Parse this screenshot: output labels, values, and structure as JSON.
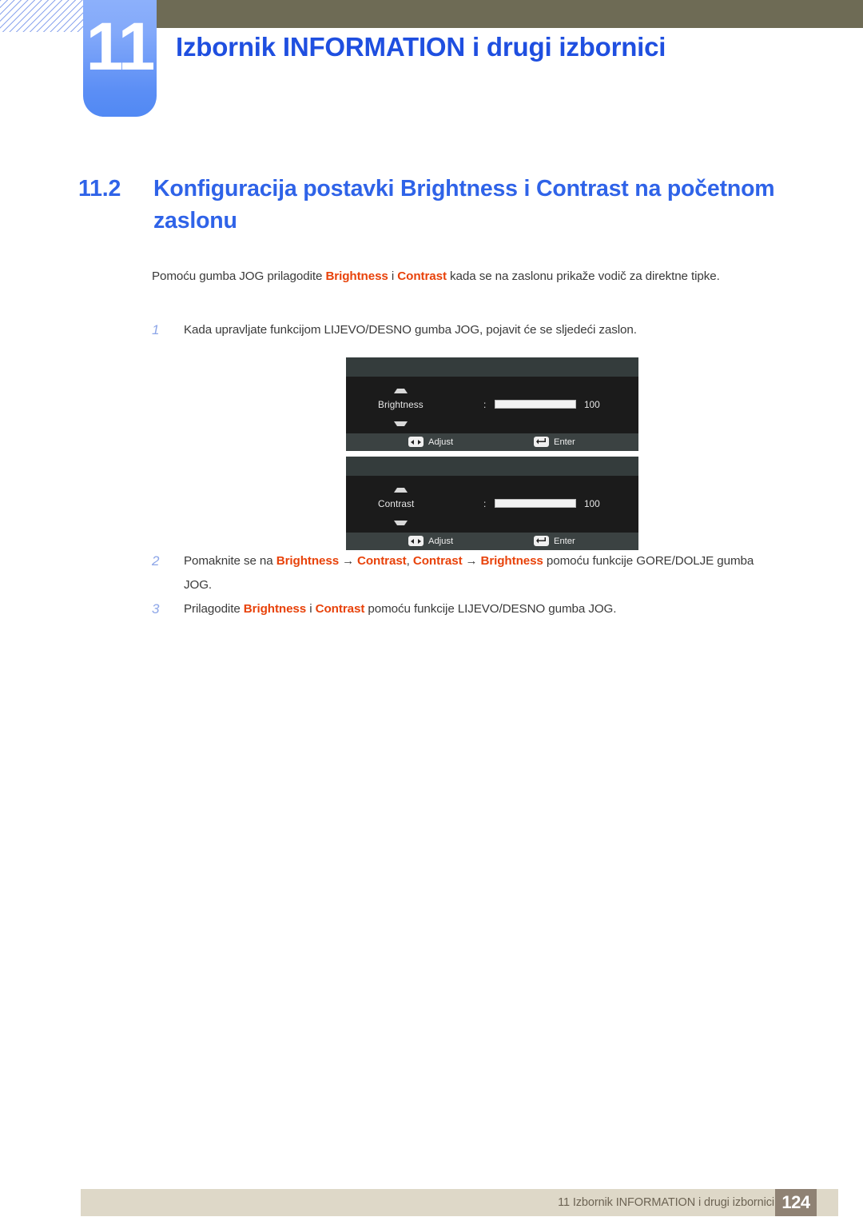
{
  "header": {
    "chapter_number": "11",
    "title": "Izbornik INFORMATION i drugi izbornici",
    "olive_color": "#6e6b55",
    "tab_color": "#5b8ef5",
    "title_color": "#1f4fe0"
  },
  "section": {
    "number": "11.2",
    "title": "Konfiguracija postavki Brightness i Contrast na početnom zaslonu",
    "heading_color": "#2f63e8"
  },
  "intro": {
    "part1": "Pomoću gumba JOG prilagodite ",
    "kw1": "Brightness",
    "part2": " i ",
    "kw2": "Contrast",
    "part3": " kada se na zaslonu prikaže vodič za direktne tipke."
  },
  "steps": [
    {
      "number": "1",
      "text": "Kada upravljate funkcijom LIJEVO/DESNO gumba JOG, pojavit će se sljedeći zaslon."
    },
    {
      "number": "2",
      "lead": "Pomaknite se na ",
      "kw1": "Brightness",
      "arrow1": "→",
      "kw2": "Contrast",
      "sep": ", ",
      "kw3": "Contrast",
      "arrow2": "→",
      "kw4": "Brightness",
      "tail": " pomoću funkcije GORE/DOLJE gumba JOG."
    },
    {
      "number": "3",
      "lead": "Prilagodite ",
      "kw1": "Brightness",
      "mid": " i ",
      "kw2": "Contrast",
      "tail": " pomoću funkcije LIJEVO/DESNO gumba JOG."
    }
  ],
  "keyword_color": "#e8420a",
  "osd_panels": [
    {
      "label": "Brightness",
      "colon": ":",
      "value": "100",
      "fill_percent": 100,
      "hint_adjust": "Adjust",
      "hint_enter": "Enter",
      "arrow_up_icon": "triangle-up-icon",
      "arrow_down_icon": "triangle-down-icon"
    },
    {
      "label": "Contrast",
      "colon": ":",
      "value": "100",
      "fill_percent": 100,
      "hint_adjust": "Adjust",
      "hint_enter": "Enter",
      "arrow_up_icon": "triangle-up-icon",
      "arrow_down_icon": "triangle-down-icon"
    }
  ],
  "footer": {
    "text": "11 Izbornik INFORMATION i drugi izbornici",
    "page_number": "124",
    "bar_color": "#ded8c8",
    "box_color": "#8f8274"
  }
}
